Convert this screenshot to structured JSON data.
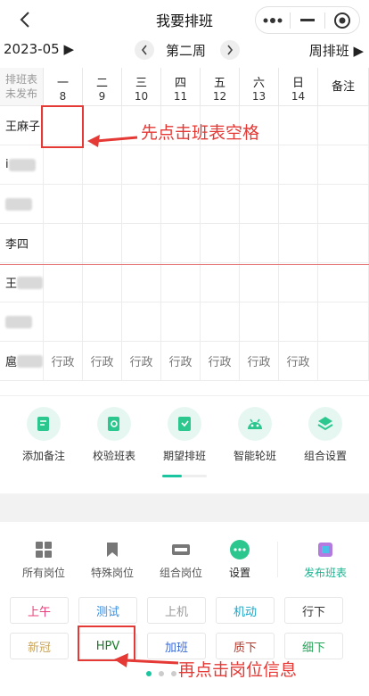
{
  "header": {
    "title": "我要排班"
  },
  "week_nav": {
    "month": "2023-05 ▶",
    "week": "第二周",
    "mode": "周排班 ▶"
  },
  "grid": {
    "first_header": [
      "排班表",
      "未发布"
    ],
    "days": [
      {
        "name": "一",
        "date": "8"
      },
      {
        "name": "二",
        "date": "9"
      },
      {
        "name": "三",
        "date": "10"
      },
      {
        "name": "四",
        "date": "11"
      },
      {
        "name": "五",
        "date": "12"
      },
      {
        "name": "六",
        "date": "13"
      },
      {
        "name": "日",
        "date": "14"
      }
    ],
    "note_header": "备注",
    "rows": [
      {
        "name": "王麻子",
        "shifts": [
          "",
          "",
          "",
          "",
          "",
          "",
          ""
        ]
      },
      {
        "name": "i",
        "shifts": [
          "",
          "",
          "",
          "",
          "",
          "",
          ""
        ]
      },
      {
        "name": "",
        "shifts": [
          "",
          "",
          "",
          "",
          "",
          "",
          ""
        ]
      },
      {
        "name": "李四",
        "shifts": [
          "",
          "",
          "",
          "",
          "",
          "",
          ""
        ]
      },
      {
        "name": "王",
        "shifts": [
          "",
          "",
          "",
          "",
          "",
          "",
          ""
        ]
      },
      {
        "name": "",
        "shifts": [
          "",
          "",
          "",
          "",
          "",
          "",
          ""
        ]
      },
      {
        "name": "扈",
        "shifts": [
          "行政",
          "行政",
          "行政",
          "行政",
          "行政",
          "行政",
          "行政"
        ]
      }
    ]
  },
  "annotations": {
    "step1": "先点击班表空格",
    "step2": "再点击岗位信息"
  },
  "functions": [
    {
      "label": "添加备注",
      "icon": "edit-note-icon"
    },
    {
      "label": "校验班表",
      "icon": "verify-doc-icon"
    },
    {
      "label": "期望排班",
      "icon": "wish-schedule-icon"
    },
    {
      "label": "智能轮班",
      "icon": "robot-icon"
    },
    {
      "label": "组合设置",
      "icon": "layers-icon"
    }
  ],
  "tools": [
    {
      "label": "所有岗位",
      "icon": "grid-icon"
    },
    {
      "label": "特殊岗位",
      "icon": "bookmark-icon"
    },
    {
      "label": "组合岗位",
      "icon": "combo-icon"
    },
    {
      "label": "设置",
      "icon": "more-dots-icon"
    },
    {
      "label": "发布班表",
      "icon": "publish-icon"
    }
  ],
  "chips": [
    {
      "label": "上午",
      "color": "#e8407a"
    },
    {
      "label": "测试",
      "color": "#3a8de0"
    },
    {
      "label": "上机",
      "color": "#9a9a9a"
    },
    {
      "label": "机动",
      "color": "#1aa5c6"
    },
    {
      "label": "行下",
      "color": "#333333"
    },
    {
      "label": "新冠",
      "color": "#c9a55a"
    },
    {
      "label": "HPV",
      "color": "#1a7a2a"
    },
    {
      "label": "加班",
      "color": "#3a6ad8"
    },
    {
      "label": "质下",
      "color": "#b03a2e"
    },
    {
      "label": "细下",
      "color": "#2aa35a"
    }
  ],
  "colors": {
    "accent": "#19c6a0",
    "annotation": "#e53935"
  }
}
